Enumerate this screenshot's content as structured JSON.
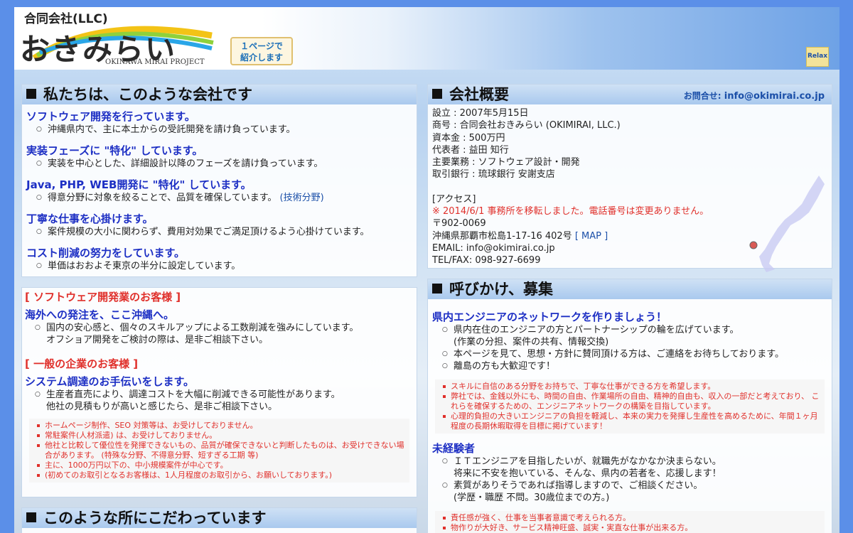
{
  "header": {
    "logo_llc": "合同会社(LLC)",
    "logo_name": "おきみらい",
    "logo_project": "OKINAWA MIRAI PROJECT",
    "intro_line1": "１ページで",
    "intro_line2": "紹介します",
    "relax": "Relax"
  },
  "about": {
    "title": "私たちは、このような会社です",
    "items": [
      {
        "heading": "ソフトウェア開発を行っています。",
        "text": "沖縄県内で、主に本土からの受託開発を請け負っています。"
      },
      {
        "heading": "実装フェーズに \"特化\" しています。",
        "text": "実装を中心とした、詳細設計以降のフェーズを請け負っています。"
      },
      {
        "heading": "Java, PHP, WEB開発に \"特化\" しています。",
        "text": "得意分野に対象を絞ることで、品質を確保しています。",
        "link_open": "(",
        "link": "技術分野",
        "link_close": ")"
      },
      {
        "heading": "丁寧な仕事を心掛けます。",
        "text": "案件規模の大小に関わらず、費用対効果でご満足頂けるよう心掛けています。"
      },
      {
        "heading": "コスト削減の努力をしています。",
        "text": "単価はおおよそ東京の半分に設定しています。"
      }
    ]
  },
  "customers": {
    "sw_label": "[ ソフトウェア開発業のお客様 ]",
    "sw_heading": "海外への発注を、ここ沖縄へ。",
    "sw_text1": "国内の安心感と、個々のスキルアップによる工数削減を強みにしています。",
    "sw_text2": "オフショア開発をご検討の際は、是非ご相談下さい。",
    "gen_label": "[ 一般の企業のお客様 ]",
    "gen_heading": "システム調達のお手伝いをします。",
    "gen_text1": "生産者直売により、調達コストを大幅に削減できる可能性があります。",
    "gen_text2": "他社の見積もりが高いと感じたら、是非ご相談下さい。",
    "notes": [
      "ホームページ制作、SEO 対策等は、お受けしておりません。",
      "常駐案件(人材派遣) は、お受けしておりません。",
      "他社と比較して優位性を発揮できないもの、品質が確保できないと判断したものは、お受けできない場合があります。 (特殊な分野、不得意分野、短すぎる工期 等)",
      "主に、1000万円以下の、中小規模案件が中心です。",
      "(初めてのお取引となるお客様は、1人月程度のお取引から、お願いしております。)"
    ]
  },
  "kodawari": {
    "title": "このような所にこだわっています"
  },
  "company": {
    "title": "会社概要",
    "contact_label": "お問合せ:",
    "contact_email": "info@okimirai.co.jp",
    "lines": [
      "設立 : 2007年5月15日",
      "商号 : 合同会社おきみらい (OKIMIRAI, LLC.)",
      "資本金 : 500万円",
      "代表者 : 益田 知行",
      "主要業務 : ソフトウェア設計・開発",
      "取引銀行 : 琉球銀行 安謝支店"
    ],
    "access_label": "[アクセス]",
    "notice": "※ 2014/6/1 事務所を移転しました。電話番号は変更ありません。",
    "postal": "〒902-0069",
    "address": "沖縄県那覇市松島1-17-16 402号",
    "map_link": "[ MAP ]",
    "email": "EMAIL: info@okimirai.co.jp",
    "tel": "TEL/FAX: 098-927-6699"
  },
  "recruit": {
    "title": "呼びかけ、募集",
    "heading1": "県内エンジニアのネットワークを作りましょう！",
    "items1": [
      "県内在住のエンジニアの方とパートナーシップの輪を広げています。",
      "(作業の分担、案件の共有、情報交換)",
      "本ページを見て、思想・方針に賛同頂ける方は、ご連絡をお待ちしております。",
      "離島の方も大歓迎です！"
    ],
    "notes1": [
      "スキルに自信のある分野をお持ちで、丁寧な仕事ができる方を希望します。",
      "弊社では、金銭以外にも、時間の自由、作業場所の自由、精神的自由も、収入の一部だと考えており、 これらを確保するための、エンジニアネットワークの構築を目指しています。",
      "心理的負担の大きいエンジニアの負担を軽減し、本来の実力を発揮し生産性を高めるために、年間１ヶ月程度の長期休暇取得を目標に掲げています！"
    ],
    "heading2": "未経験者",
    "items2": [
      "ＩＴエンジニアを目指したいが、就職先がなかなか決まらない。",
      "将来に不安を抱いている、そんな、県内の若者を、応援します！",
      "素質がありそうであれば指導しますので、ご相談ください。",
      "(学歴・職歴 不問。30歳位までの方。)"
    ],
    "notes2": [
      "責任感が強く、仕事を当事者意識で考えられる方。",
      "物作りが大好き、サービス精神旺盛、誠実・実直な仕事が出来る方。"
    ]
  }
}
